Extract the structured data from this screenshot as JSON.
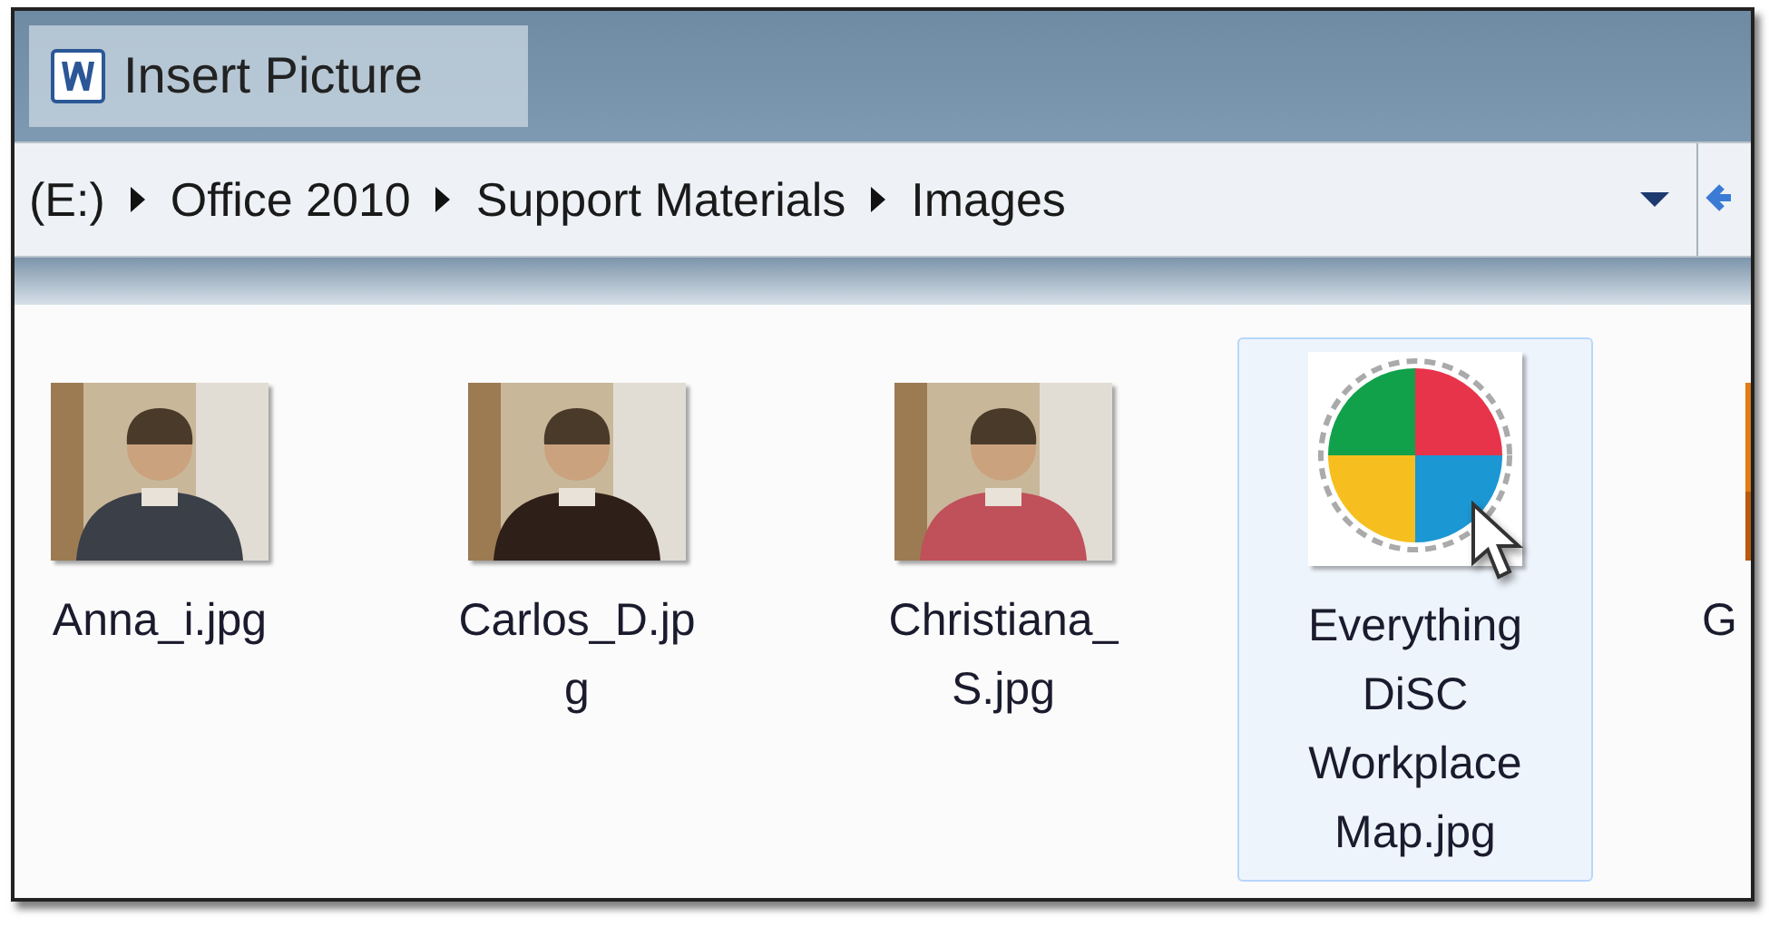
{
  "window": {
    "title": "Insert Picture"
  },
  "breadcrumb": [
    "(E:)",
    "Office 2010",
    "Support Materials",
    "Images"
  ],
  "files": [
    {
      "label_lines": [
        "Anna_i.jpg"
      ],
      "selected": false,
      "color": "#3a3f48"
    },
    {
      "label_lines": [
        "Carlos_D.jp",
        "g"
      ],
      "selected": false,
      "color": "#2e2018"
    },
    {
      "label_lines": [
        "Christiana_",
        "S.jpg"
      ],
      "selected": false,
      "color": "#c0505a"
    },
    {
      "kind": "chart",
      "label_lines": [
        "Everything",
        "DiSC",
        "Workplace",
        "Map.jpg"
      ],
      "selected": true
    },
    {
      "kind": "partial",
      "label_lines": [
        "G"
      ],
      "selected": false
    }
  ]
}
